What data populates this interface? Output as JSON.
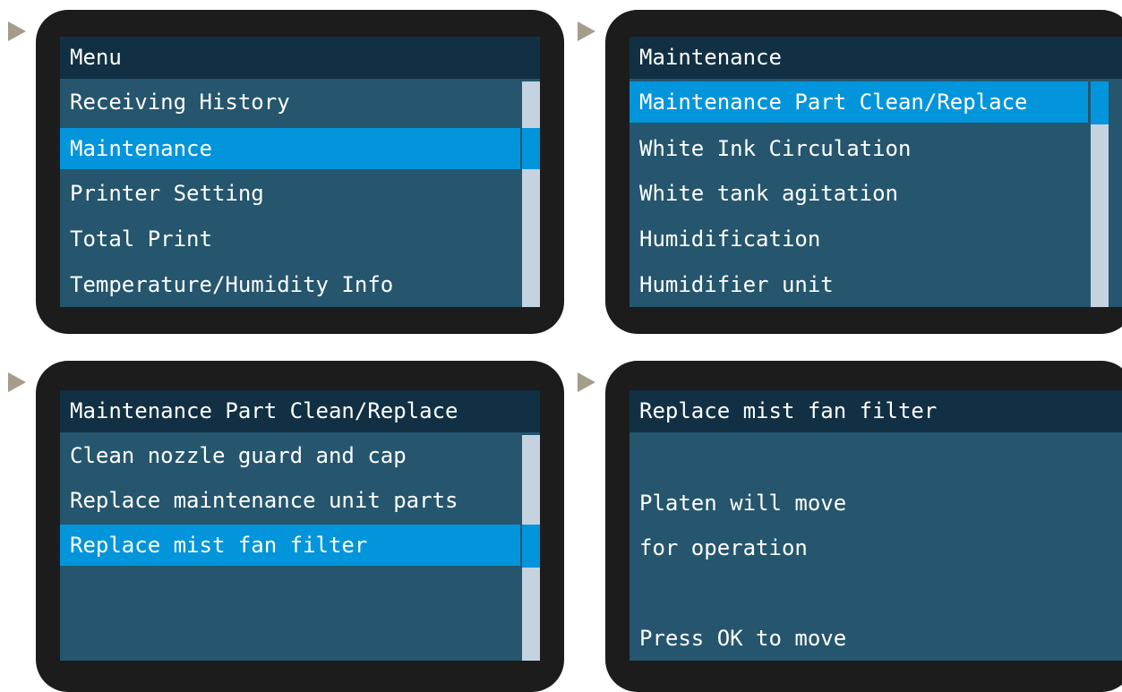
{
  "panels": [
    {
      "title": "Menu",
      "items": [
        "Receiving History",
        "Maintenance",
        "Printer Setting",
        "Total Print",
        "Temperature/Humidity Info"
      ]
    },
    {
      "title": "Maintenance",
      "items": [
        "Maintenance Part Clean/Replace",
        "White Ink Circulation",
        "White tank agitation",
        "Humidification",
        "Humidifier unit"
      ]
    },
    {
      "title": "Maintenance Part Clean/Replace",
      "items": [
        "Clean nozzle guard and cap",
        "Replace maintenance unit parts",
        "Replace mist fan filter"
      ]
    },
    {
      "title": "Replace mist fan filter",
      "message_line1": "Platen will move",
      "message_line2": "for operation",
      "prompt": "Press OK to move"
    }
  ],
  "colors": {
    "bezel": "#1c1c1c",
    "screen_bg": "#25566e",
    "title_bg": "#113044",
    "selected": "#0395db",
    "scroll_track": "#c5d2e0",
    "arrow": "#a59c8c"
  }
}
